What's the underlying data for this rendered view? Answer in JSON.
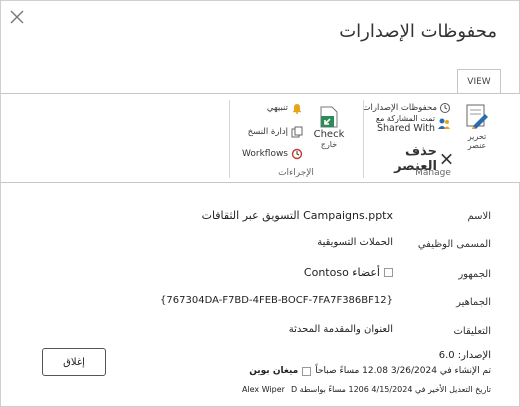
{
  "dialog": {
    "title": "محفوظات الإصدارات",
    "close_icon": "close-icon"
  },
  "ribbon": {
    "tab_view": "VIEW",
    "manage_group": {
      "label": "Manage",
      "edit_item": "تحرير عنصر",
      "version_history": "محفوظات الإصدارات",
      "shared_with_line1": "تمت المشاركة مع",
      "shared_with_line2": "Shared With",
      "delete_item": "حذف العنصر"
    },
    "actions_group": {
      "label": "الإجراءات",
      "check_out_line1": "Check",
      "check_out_line2": "خارج",
      "alert_me": "تنبيهي",
      "manage_copies": "إدارة النسخ",
      "workflows": "Workflows"
    }
  },
  "properties": {
    "name": {
      "label": "الاسم",
      "value": "Campaigns.pptx التسويق عبر الثقافات"
    },
    "job_title": {
      "label": "المسمى الوظيفي",
      "value": "الحملات التسويقية"
    },
    "audience": {
      "label": "الجمهور",
      "value": "أعضاء Contoso"
    },
    "audiences": {
      "label": "الجماهير",
      "value": "{767304DA-F7BD-4FEB-BOCF-7FA7F386BF12}"
    },
    "comments": {
      "label": "التعليقات",
      "value": "العنوان والمقدمة المحدثة"
    }
  },
  "footer": {
    "version_line": "الإصدار: 6.0",
    "created_line": "تم الإنشاء في 3/26/2024 12.08 مساءً صباحاً",
    "created_by": "ميغان بوين",
    "modified_line": "تاريخ التعديل الأخير في 4/15/2024 1206 مساءً بواسطة D",
    "modified_by": "Alex Wiper"
  },
  "buttons": {
    "close": "إغلاق"
  },
  "colors": {
    "accent_green": "#2e8b57",
    "accent_blue": "#2b6cb0",
    "alert_orange": "#e8a317"
  }
}
